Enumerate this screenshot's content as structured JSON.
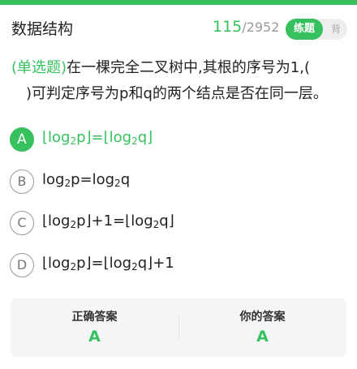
{
  "header": {
    "title": "数据结构",
    "current": "115",
    "separator": "/",
    "total": "2952",
    "mode_active": "练题",
    "mode_inactive": "背"
  },
  "question": {
    "type_label": "(单选题)",
    "line1": "在一棵完全二叉树中,其根的序号为1,(",
    "line2": ")可判定序号为p和q的两个结点是否在同一层。"
  },
  "options": [
    {
      "letter": "A",
      "base1": "⌊log",
      "sub1": "2",
      "mid": "p⌋=⌊log",
      "sub2": "2",
      "end": "q⌋",
      "selected": true
    },
    {
      "letter": "B",
      "base1": "log",
      "sub1": "2",
      "mid": "p=log",
      "sub2": "2",
      "end": "q",
      "selected": false
    },
    {
      "letter": "C",
      "base1": "⌊log",
      "sub1": "2",
      "mid": "p⌋+1=⌊log",
      "sub2": "2",
      "end": "q⌋",
      "selected": false
    },
    {
      "letter": "D",
      "base1": "⌊log",
      "sub1": "2",
      "mid": "p⌋=⌊log",
      "sub2": "2",
      "end": "q⌋+1",
      "selected": false
    }
  ],
  "answer": {
    "correct_label": "正确答案",
    "correct_value": "A",
    "yours_label": "你的答案",
    "yours_value": "A"
  },
  "colors": {
    "accent": "#36c15e"
  }
}
